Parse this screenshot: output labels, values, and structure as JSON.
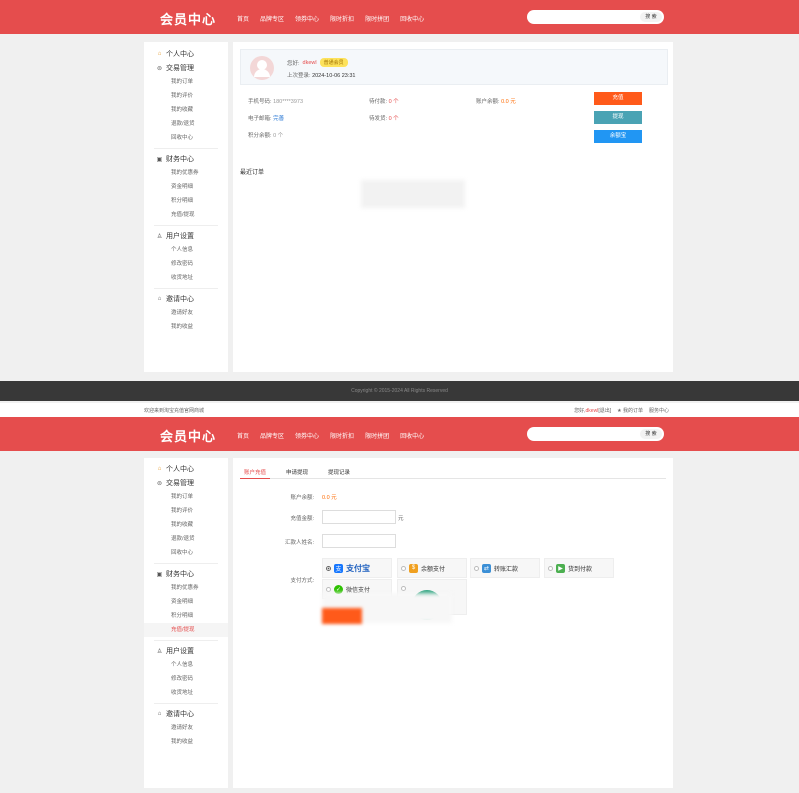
{
  "header": {
    "logo": "会员中心",
    "nav": [
      "首页",
      "品牌专区",
      "领券中心",
      "限时折扣",
      "限时拼团",
      "回收中心"
    ],
    "search_button": "搜 索"
  },
  "sidebar": {
    "groups": [
      {
        "title": "个人中心",
        "icon": "home-icon",
        "items": []
      },
      {
        "title": "交易管理",
        "icon": "trade-icon",
        "items": [
          "我的订单",
          "我的评价",
          "我的收藏",
          "退款/退货",
          "回收中心"
        ]
      },
      {
        "title": "财务中心",
        "icon": "finance-icon",
        "items": [
          "我的优惠券",
          "资金明细",
          "积分明细",
          "充值/提现"
        ]
      },
      {
        "title": "用户设置",
        "icon": "user-icon",
        "items": [
          "个人信息",
          "修改密码",
          "收货地址"
        ]
      },
      {
        "title": "邀请中心",
        "icon": "invite-icon",
        "items": [
          "邀请好友",
          "我的收益"
        ]
      }
    ]
  },
  "profile": {
    "greeting_label": "您好:",
    "username": "dkewl",
    "level_badge": "普通会员",
    "last_login_label": "上次登录:",
    "last_login": "2024-10-06 23:31"
  },
  "account": {
    "phone_label": "手机号码:",
    "phone": "180****3973",
    "email_label": "电子邮箱:",
    "email": "完善",
    "points_label": "积分余额:",
    "points": "0 个",
    "unpaid_label": "待付款:",
    "unpaid": "0 个",
    "unshipped_label": "待发货:",
    "unshipped": "0 个",
    "balance_label": "账户余额:",
    "balance": "0.0 元",
    "btn_recharge": "充值",
    "btn_withdraw": "提现",
    "btn_alipay": "余额宝"
  },
  "recent_orders_title": "最近订单",
  "footer": {
    "copyright": "Copyright © 2015-2024 All Rights Reserved"
  },
  "topbar": {
    "welcome": "欢迎来到淘宝充值官网商城",
    "greeting": "您好,",
    "username": "dkewl",
    "logout": "[退出]",
    "my_orders": "★ 我的订单",
    "service": "服务中心"
  },
  "recharge": {
    "tabs": [
      "账户充值",
      "申请提现",
      "提现记录"
    ],
    "balance_label": "账户余额:",
    "balance": "0.0 元",
    "amount_label": "充值金额:",
    "amount_unit": "元",
    "remitter_label": "汇款人姓名:",
    "method_label": "支付方式:",
    "methods": [
      "支付宝",
      "余额支付",
      "转账汇款",
      "货到付款",
      "微信支付"
    ]
  },
  "colors": {
    "brand": "#e54d4d",
    "orange": "#ff5a1a",
    "teal": "#4aa3b4",
    "blue": "#2196f3"
  }
}
